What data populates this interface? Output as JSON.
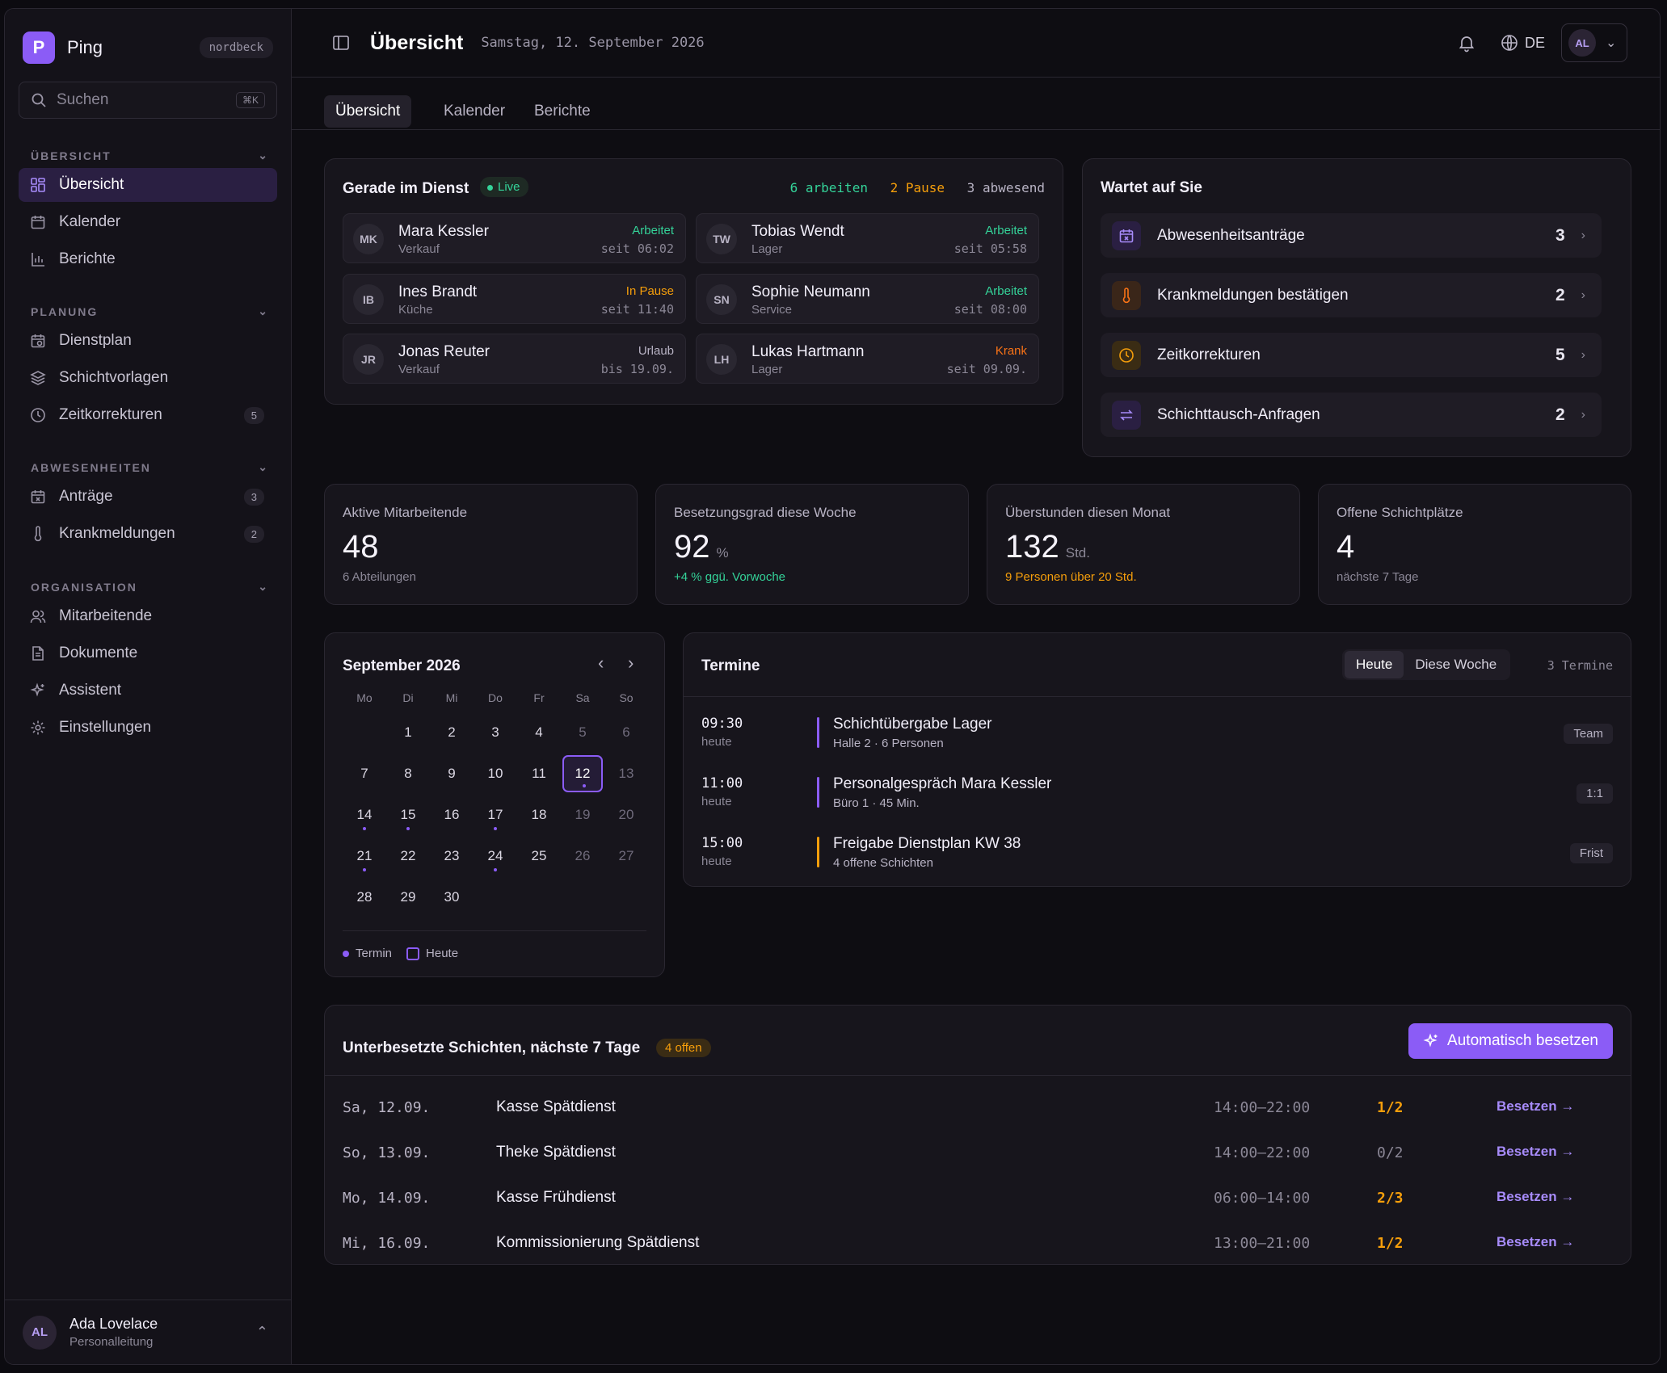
{
  "sidebar": {
    "brand": "Ping",
    "logo_letter": "P",
    "tenant": "nordbeck",
    "search_placeholder": "Suchen",
    "search_shortcut": "⌘K",
    "sections": [
      {
        "label": "ÜBERSICHT"
      },
      {
        "label": "PLANUNG"
      },
      {
        "label": "ABWESENHEITEN"
      },
      {
        "label": "ORGANISATION"
      }
    ],
    "items": [
      {
        "label": "Übersicht"
      },
      {
        "label": "Kalender"
      },
      {
        "label": "Berichte"
      },
      {
        "label": "Dienstplan"
      },
      {
        "label": "Schichtvorlagen"
      },
      {
        "label": "Zeitkorrekturen",
        "count": "5"
      },
      {
        "label": "Anträge",
        "count": "3"
      },
      {
        "label": "Krankmeldungen",
        "count": "2"
      },
      {
        "label": "Mitarbeitende"
      },
      {
        "label": "Dokumente"
      },
      {
        "label": "Assistent"
      },
      {
        "label": "Einstellungen"
      }
    ],
    "user": {
      "initials": "AL",
      "name": "Ada Lovelace",
      "role": "Personalleitung"
    }
  },
  "header": {
    "title": "Übersicht",
    "date": "Samstag, 12. September 2026",
    "language": "DE",
    "avatar": "AL"
  },
  "tabs": [
    "Übersicht",
    "Kalender",
    "Berichte"
  ],
  "on_duty": {
    "title": "Gerade im Dienst",
    "live": "Live",
    "working": "6 arbeiten",
    "paused": "2 Pause",
    "absent": "3 abwesend",
    "employees": [
      {
        "initials": "MK",
        "name": "Mara Kessler",
        "dept": "Verkauf",
        "status": "Arbeitet",
        "since": "seit 06:02"
      },
      {
        "initials": "TW",
        "name": "Tobias Wendt",
        "dept": "Lager",
        "status": "Arbeitet",
        "since": "seit 05:58"
      },
      {
        "initials": "IB",
        "name": "Ines Brandt",
        "dept": "Küche",
        "status": "In Pause",
        "since": "seit 11:40"
      },
      {
        "initials": "SN",
        "name": "Sophie Neumann",
        "dept": "Service",
        "status": "Arbeitet",
        "since": "seit 08:00"
      },
      {
        "initials": "JR",
        "name": "Jonas Reuter",
        "dept": "Verkauf",
        "status": "Urlaub",
        "since": "bis 19.09."
      },
      {
        "initials": "LH",
        "name": "Lukas Hartmann",
        "dept": "Lager",
        "status": "Krank",
        "since": "seit 09.09."
      }
    ]
  },
  "waiting": {
    "title": "Wartet auf Sie",
    "items": [
      {
        "label": "Abwesenheitsanträge",
        "count": "3",
        "icon": "calendar-x-icon"
      },
      {
        "label": "Krankmeldungen bestätigen",
        "count": "2",
        "icon": "thermometer-icon"
      },
      {
        "label": "Zeitkorrekturen",
        "count": "5",
        "icon": "clock-icon"
      },
      {
        "label": "Schichttausch-Anfragen",
        "count": "2",
        "icon": "swap-icon"
      }
    ]
  },
  "stats": [
    {
      "label": "Aktive Mitarbeitende",
      "value": "48",
      "unit": "",
      "sub": "6 Abteilungen"
    },
    {
      "label": "Besetzungsgrad diese Woche",
      "value": "92",
      "unit": "%",
      "sub": "+4 % ggü. Vorwoche"
    },
    {
      "label": "Überstunden diesen Monat",
      "value": "132",
      "unit": "Std.",
      "sub": "9 Personen über 20 Std."
    },
    {
      "label": "Offene Schichtplätze",
      "value": "4",
      "unit": "",
      "sub": "nächste 7 Tage"
    }
  ],
  "calendar": {
    "title": "September 2026",
    "weekdays": [
      "Mo",
      "Di",
      "Mi",
      "Do",
      "Fr",
      "Sa",
      "So"
    ],
    "today": 12,
    "event_days": [
      12,
      14,
      15,
      17,
      21,
      24
    ],
    "legend_event": "Termin",
    "legend_today": "Heute"
  },
  "appointments": {
    "title": "Termine",
    "filter_today": "Heute",
    "filter_week": "Diese Woche",
    "count": "3 Termine",
    "items": [
      {
        "time": "09:30",
        "day": "heute",
        "title": "Schichtübergabe Lager",
        "sub": "Halle 2 · 6 Personen",
        "tag": "Team",
        "color": "#8b5cf6"
      },
      {
        "time": "11:00",
        "day": "heute",
        "title": "Personalgespräch Mara Kessler",
        "sub": "Büro 1 · 45 Min.",
        "tag": "1:1",
        "color": "#8b5cf6"
      },
      {
        "time": "15:00",
        "day": "heute",
        "title": "Freigabe Dienstplan KW 38",
        "sub": "4 offene Schichten",
        "tag": "Frist",
        "color": "#f59e0b"
      }
    ]
  },
  "understaffed": {
    "title": "Unterbesetzte Schichten, nächste 7 Tage",
    "badge": "4 offen",
    "button": "Automatisch besetzen",
    "rows": [
      {
        "date": "Sa, 12.09.",
        "name": "Kasse Spätdienst",
        "time": "14:00–22:00",
        "fill": "1/2",
        "action": "Besetzen →",
        "warn": true
      },
      {
        "date": "So, 13.09.",
        "name": "Theke Spätdienst",
        "time": "14:00–22:00",
        "fill": "0/2",
        "action": "Besetzen →",
        "warn": false
      },
      {
        "date": "Mo, 14.09.",
        "name": "Kasse Frühdienst",
        "time": "06:00–14:00",
        "fill": "2/3",
        "action": "Besetzen →",
        "warn": true
      },
      {
        "date": "Mi, 16.09.",
        "name": "Kommissionierung Spätdienst",
        "time": "13:00–21:00",
        "fill": "1/2",
        "action": "Besetzen →",
        "warn": true
      }
    ]
  },
  "colors": {
    "accent": "#8b5cf6",
    "working": "#34d399",
    "pause": "#f59e0b",
    "sick": "#f97316"
  }
}
